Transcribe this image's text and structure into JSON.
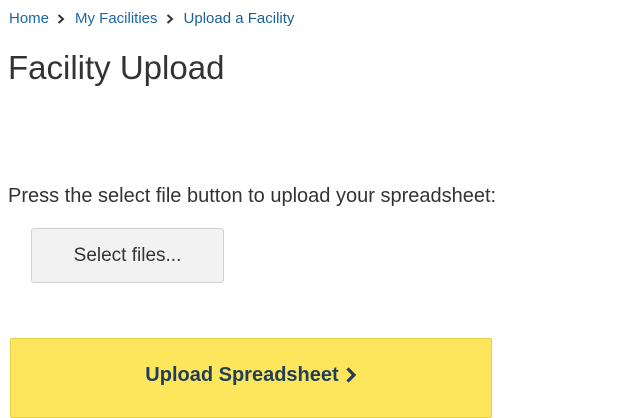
{
  "breadcrumb": {
    "home": "Home",
    "my_facilities": "My Facilities",
    "current": "Upload a Facility"
  },
  "page": {
    "title": "Facility Upload",
    "instructions": "Press the select file button to upload your spreadsheet:"
  },
  "buttons": {
    "select_files": "Select files...",
    "upload_spreadsheet": "Upload Spreadsheet"
  },
  "icons": {
    "breadcrumb_separator": "chevron-right-icon",
    "upload_chevron": "chevron-right-icon"
  },
  "colors": {
    "link": "#1a66a8",
    "upload_button_bg": "#fde55c",
    "upload_button_text": "#1f3d5c",
    "select_button_bg": "#f2f2f2"
  }
}
